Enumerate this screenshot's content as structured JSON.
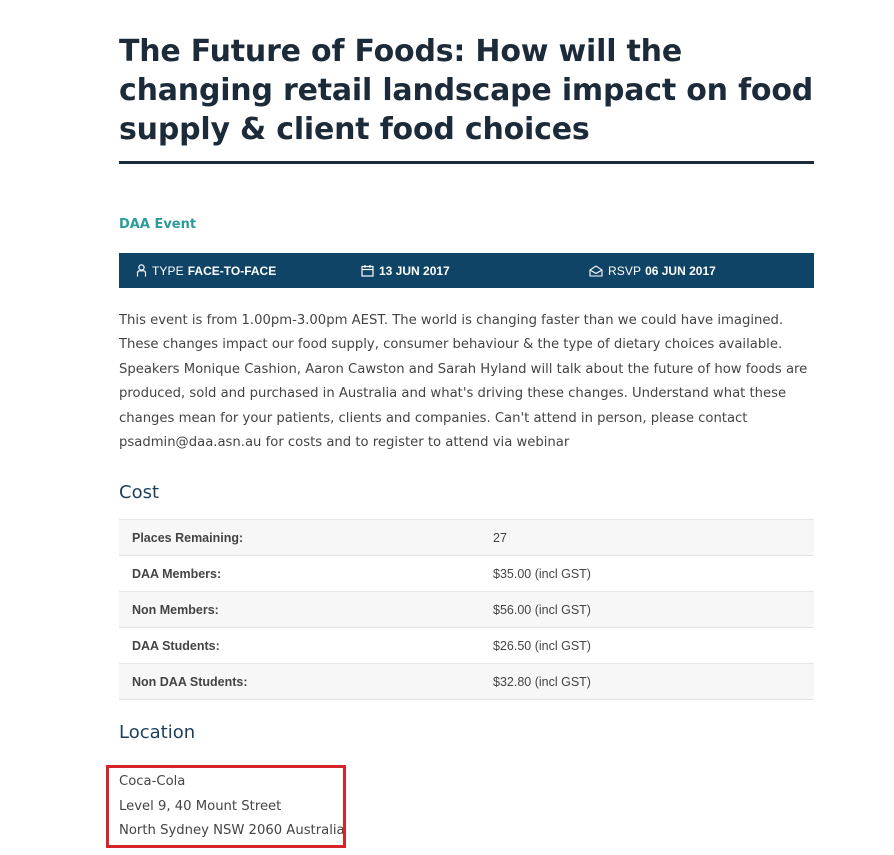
{
  "event": {
    "title": "The Future of Foods: How will the changing retail landscape impact on food supply & client food choices",
    "tag": "DAA Event"
  },
  "info_bar": {
    "type_label": "TYPE",
    "type_value": "FACE-TO-FACE",
    "type_icon": "person-icon",
    "date_value": "13 JUN 2017",
    "date_icon": "calendar-icon",
    "rsvp_label": "RSVP",
    "rsvp_value": "06 JUN 2017",
    "rsvp_icon": "envelope-open-icon",
    "bg_color": "#0f4466"
  },
  "description": "This event is from 1.00pm-3.00pm AEST. The world is changing faster than we could have imagined. These changes impact our food supply, consumer behaviour & the type of dietary choices available. Speakers Monique Cashion, Aaron Cawston and Sarah Hyland will talk about the future of how foods are produced, sold and purchased in Australia and what's driving these changes. Understand what these changes mean for your patients, clients and companies. Can't attend in person, please contact psadmin@daa.asn.au for costs and to register to attend via webinar",
  "cost": {
    "heading": "Cost",
    "rows": [
      {
        "label": "Places Remaining:",
        "value": "27"
      },
      {
        "label": "DAA Members:",
        "value": "$35.00 (incl GST)"
      },
      {
        "label": "Non Members:",
        "value": "$56.00 (incl GST)"
      },
      {
        "label": "DAA Students:",
        "value": "$26.50 (incl GST)"
      },
      {
        "label": "Non DAA Students:",
        "value": "$32.80 (incl GST)"
      }
    ]
  },
  "location": {
    "heading": "Location",
    "lines": [
      "Coca-Cola",
      "Level 9, 40 Mount Street",
      "North Sydney NSW 2060 Australia"
    ],
    "highlight_color": "#d7242c"
  },
  "colors": {
    "title": "#1c2b39",
    "tag": "#2a9c9c",
    "heading": "#1c3f5e"
  }
}
